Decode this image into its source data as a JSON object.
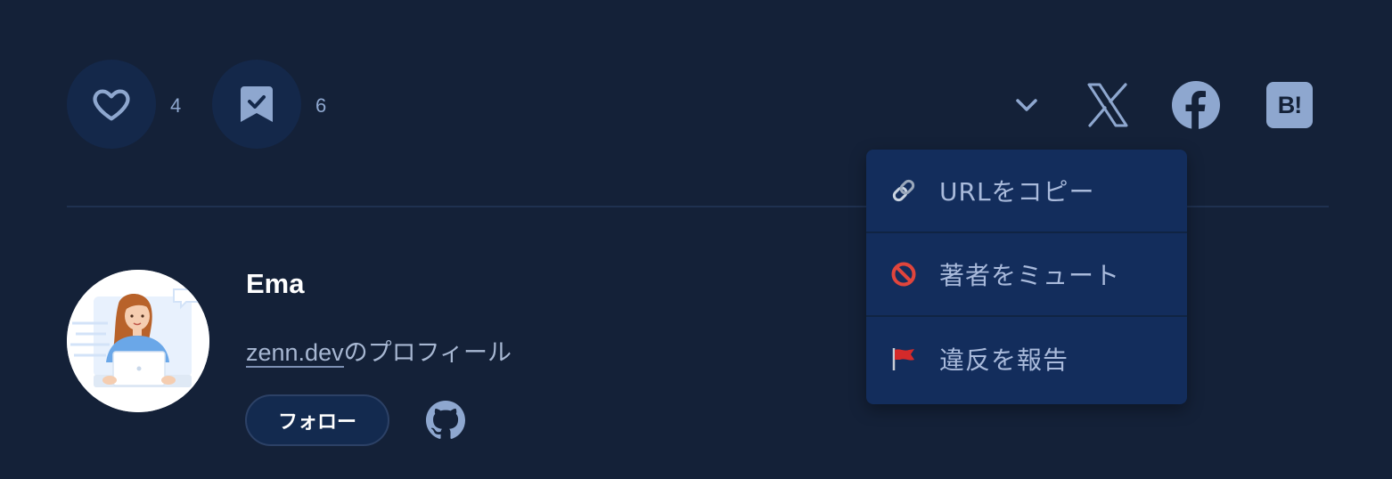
{
  "actions": {
    "like_count": "4",
    "bookmark_count": "6"
  },
  "share": {
    "more_icon": "chevron-down-icon",
    "x_icon": "x-icon",
    "facebook_icon": "facebook-icon",
    "hatena_icon": "hatena-bookmark-icon",
    "hatena_label": "B!"
  },
  "author": {
    "name": "Ema",
    "profile_link": "zenn.dev",
    "profile_suffix": "のプロフィール",
    "follow_label": "フォロー",
    "github_icon": "github-icon"
  },
  "menu": {
    "items": [
      {
        "label": "URLをコピー",
        "icon": "link-icon"
      },
      {
        "label": "著者をミュート",
        "icon": "no-entry-icon"
      },
      {
        "label": "違反を報告",
        "icon": "red-flag-icon"
      }
    ]
  },
  "colors": {
    "background": "#142138",
    "button_bg": "#14284a",
    "menu_bg": "#132d5c",
    "icon": "#8ea7cf"
  }
}
